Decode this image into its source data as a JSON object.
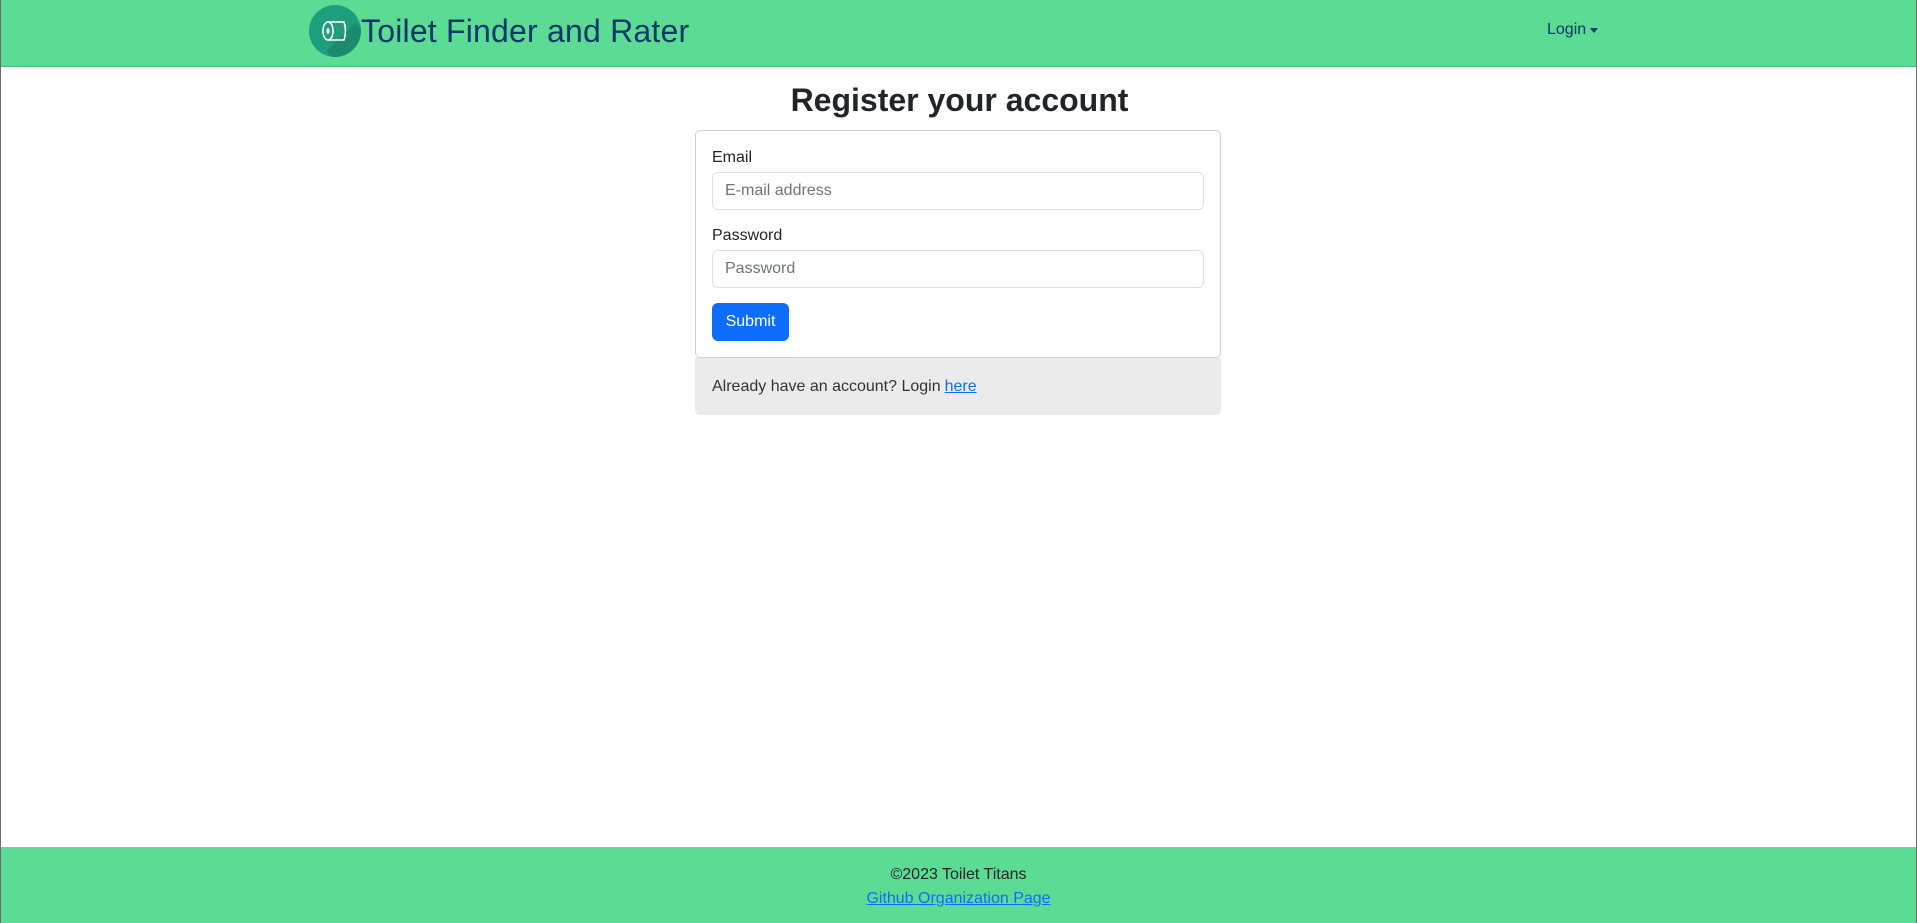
{
  "navbar": {
    "brand_title": "Toilet Finder and Rater",
    "logo_icon": "toilet-paper-icon",
    "login_label": "Login"
  },
  "main": {
    "title": "Register your account",
    "form": {
      "email_label": "Email",
      "email_placeholder": "E-mail address",
      "email_value": "",
      "password_label": "Password",
      "password_placeholder": "Password",
      "password_value": "",
      "submit_label": "Submit"
    },
    "footer_text": "Already have an account? Login",
    "footer_link": "here"
  },
  "footer": {
    "copyright": "©2023 Toilet Titans",
    "github_link": "Github Organization Page"
  },
  "colors": {
    "navbar_bg": "#5cdb95",
    "brand_text": "#05386b",
    "primary": "#0d6efd"
  }
}
